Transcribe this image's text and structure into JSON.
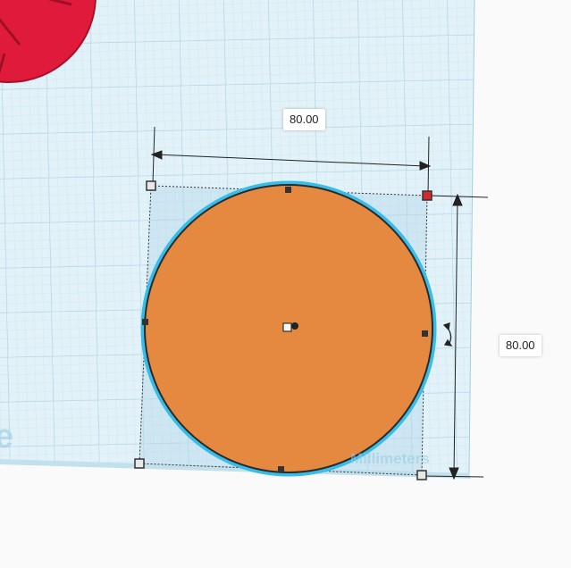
{
  "workplane": {
    "units_label": "Millimeters",
    "brand_fragment": "e"
  },
  "shape": {
    "type": "cylinder-top-view",
    "fill_color": "#e4893f",
    "outline_color": "#2a2a2a",
    "selection_glow": "#38bde8"
  },
  "other_shape": {
    "fill_color": "#e01a3b"
  },
  "dimensions": {
    "width": "80.00",
    "length": "80.00"
  },
  "colors": {
    "grid_background": "#e2f2f8",
    "grid_minor": "#c6e3ee",
    "grid_major": "#a6d2e4",
    "handle_corner": "#e8e8e8",
    "handle_active": "#d42a2a"
  }
}
